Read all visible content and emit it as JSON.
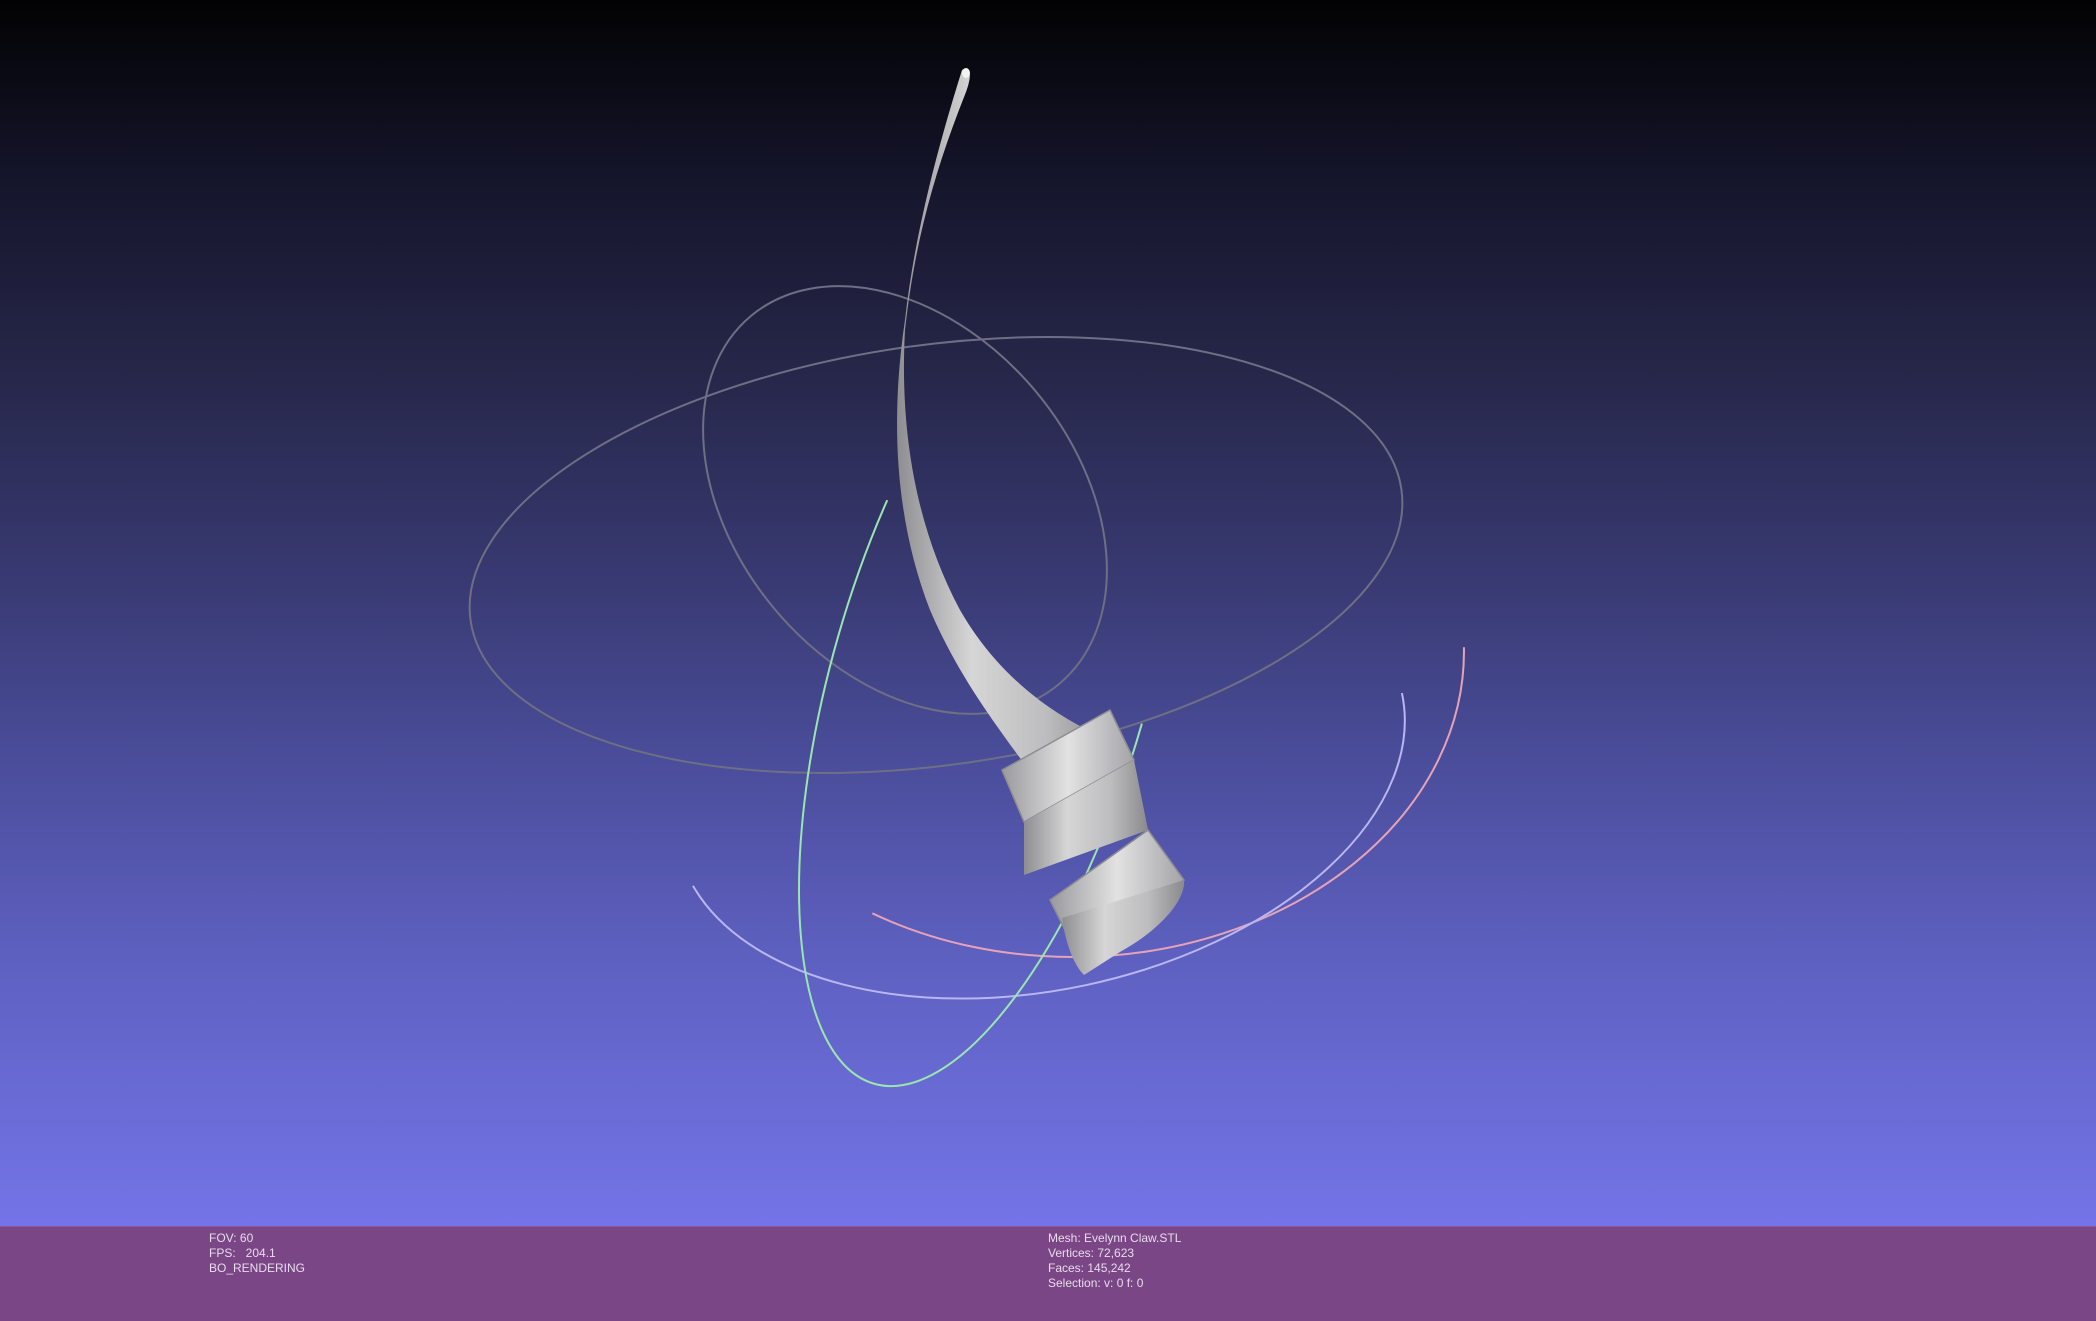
{
  "render_stats": {
    "fov": "FOV: 60",
    "fps": "FPS:   204.1",
    "mode": "BO_RENDERING"
  },
  "mesh_info": {
    "mesh": "Mesh: Evelynn Claw.STL",
    "vertices": "Vertices: 72,623",
    "faces": "Faces: 145,242",
    "selection": "Selection: v: 0 f: 0"
  },
  "colors": {
    "info_bar": "#7b4686",
    "ring_red": "#e6a3b8",
    "ring_green": "#9be6b0",
    "ring_blue": "#b9b6f2",
    "ring_gray": "#6e6f84",
    "mesh": "#c8c8c8"
  }
}
